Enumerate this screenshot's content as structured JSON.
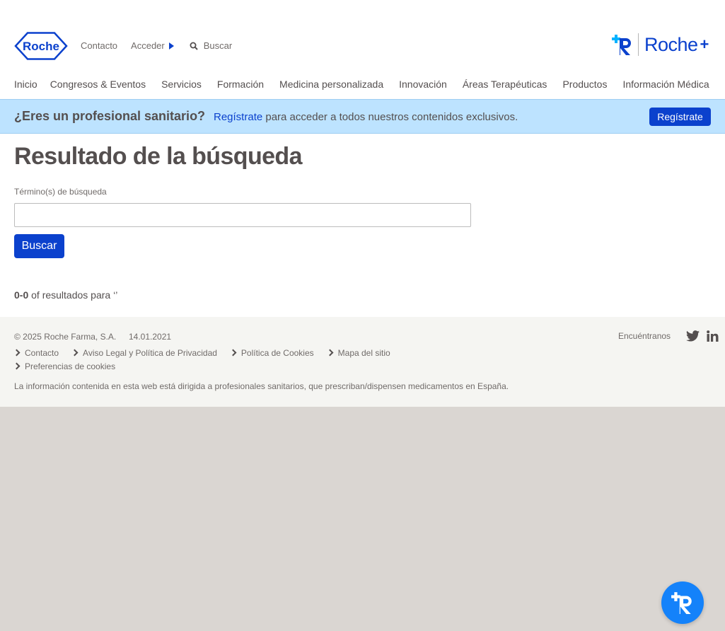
{
  "header": {
    "logo_text": "Roche",
    "contact_label": "Contacto",
    "login_label": "Acceder",
    "search_label": "Buscar",
    "brand_plus_text": "Roche",
    "brand_plus_sign": "+"
  },
  "nav": {
    "items": [
      "Inicio",
      "Congresos & Eventos",
      "Servicios",
      "Formación",
      "Medicina personalizada",
      "Innovación",
      "Áreas Terapéuticas",
      "Productos",
      "Información Médica"
    ]
  },
  "banner": {
    "question": "¿Eres un profesional sanitario?",
    "link_text": "Regístrate",
    "message_rest": " para acceder a todos nuestros contenidos exclusivos.",
    "button_label": "Regístrate"
  },
  "search_page": {
    "title": "Resultado de la búsqueda",
    "field_label": "Término(s) de búsqueda",
    "field_value": "",
    "button_label": "Buscar",
    "results_range": "0-0",
    "results_text": " of resultados para ‘’"
  },
  "footer": {
    "copyright": "© 2025 Roche Farma, S.A.",
    "date": "14.01.2021",
    "links": [
      "Contacto",
      "Aviso Legal y Política de Privacidad",
      "Política de Cookies",
      "Mapa del sitio",
      "Preferencias de cookies"
    ],
    "note": "La información contenida en esta web está dirigida a profesionales sanitarios, que prescriban/dispensen medicamentos en España.",
    "social_label": "Encuéntranos",
    "social_icons": [
      "twitter-icon",
      "linkedin-icon"
    ]
  },
  "colors": {
    "brand_blue": "#0b41cd",
    "banner_bg": "#bde3ff",
    "footer_bg": "#f5f5f2",
    "fab_blue": "#1482fa"
  }
}
